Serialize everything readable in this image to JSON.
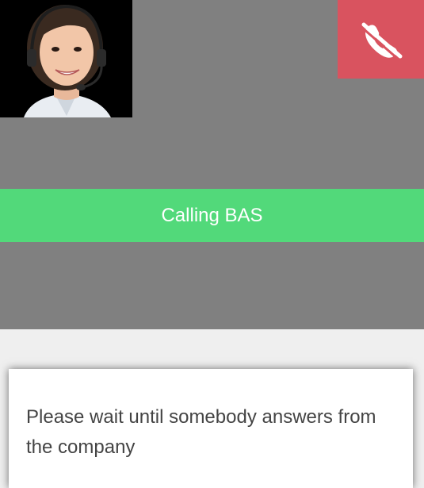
{
  "call": {
    "status_text": "Calling BAS",
    "hangup_icon": "phone-hangup-icon",
    "avatar_icon": "agent-avatar-icon"
  },
  "message": {
    "text": "Please wait until somebody answers from the company"
  },
  "colors": {
    "panel_bg": "#808080",
    "page_bg": "#efefef",
    "hangup_bg": "#d9535f",
    "banner_bg": "#52d97a",
    "banner_text": "#ffffff",
    "message_text": "#444444"
  }
}
